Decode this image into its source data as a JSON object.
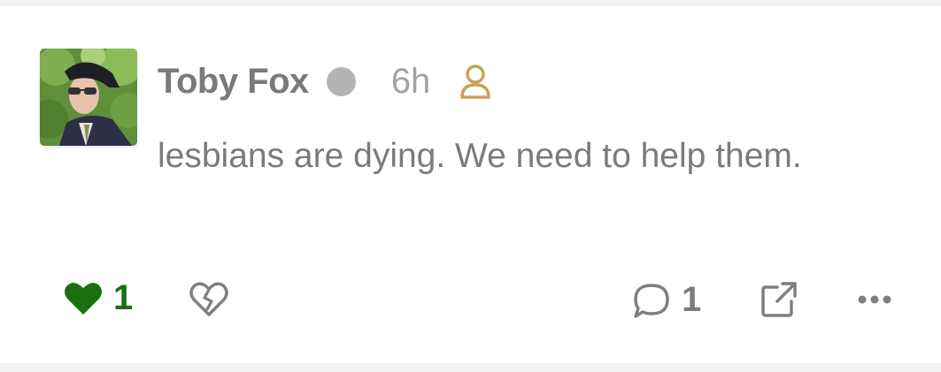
{
  "post": {
    "author": "Toby Fox",
    "time": "6h",
    "text": "lesbians are dying. We need to help them.",
    "likes": "1",
    "comments": "1"
  },
  "icons": {
    "status": "status-dot-icon",
    "user": "user-icon",
    "like": "heart-icon",
    "dislike": "broken-heart-icon",
    "comment": "comment-bubble-icon",
    "share": "external-link-icon",
    "more": "more-dots-icon"
  },
  "colors": {
    "like_active": "#1b6f10",
    "user_icon": "#c9a15a",
    "text": "#7b7b7b",
    "muted": "#a2a2a2"
  }
}
